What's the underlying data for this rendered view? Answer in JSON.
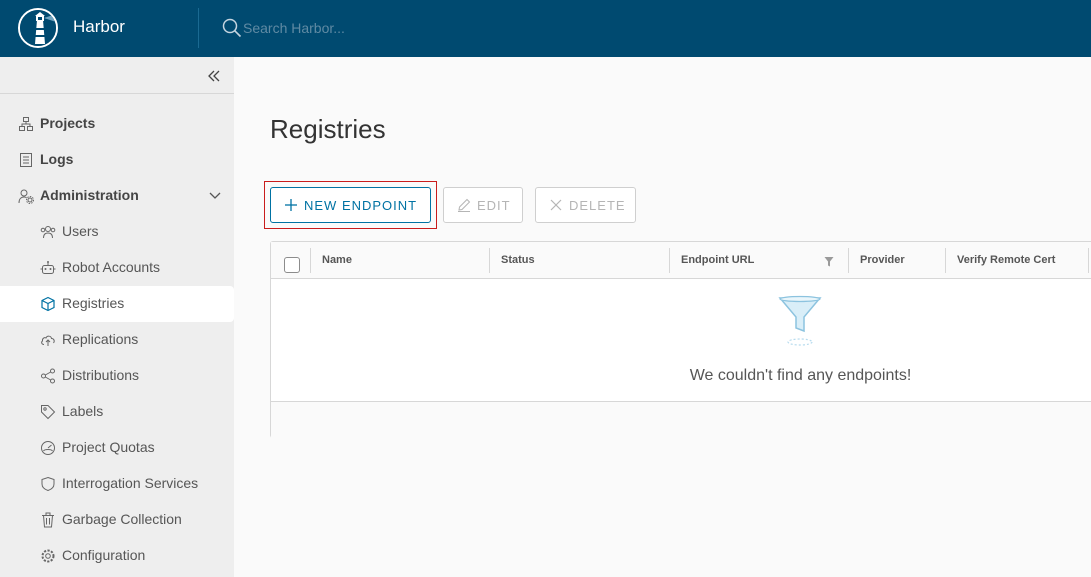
{
  "header": {
    "brand": "Harbor",
    "search_placeholder": "Search Harbor..."
  },
  "sidebar": {
    "items": [
      {
        "label": "Projects",
        "icon": "projects-icon"
      },
      {
        "label": "Logs",
        "icon": "logs-icon"
      },
      {
        "label": "Administration",
        "icon": "administration-icon",
        "expanded": true
      },
      {
        "label": "Users",
        "icon": "users-icon"
      },
      {
        "label": "Robot Accounts",
        "icon": "robot-icon"
      },
      {
        "label": "Registries",
        "icon": "registries-icon",
        "active": true
      },
      {
        "label": "Replications",
        "icon": "replications-icon"
      },
      {
        "label": "Distributions",
        "icon": "distributions-icon"
      },
      {
        "label": "Labels",
        "icon": "labels-icon"
      },
      {
        "label": "Project Quotas",
        "icon": "quotas-icon"
      },
      {
        "label": "Interrogation Services",
        "icon": "interrogation-icon"
      },
      {
        "label": "Garbage Collection",
        "icon": "trash-icon"
      },
      {
        "label": "Configuration",
        "icon": "gear-icon"
      }
    ]
  },
  "main": {
    "title": "Registries",
    "toolbar": {
      "new_label": "NEW ENDPOINT",
      "edit_label": "EDIT",
      "delete_label": "DELETE"
    },
    "grid": {
      "columns": [
        "Name",
        "Status",
        "Endpoint URL",
        "Provider",
        "Verify Remote Cert"
      ],
      "empty_message": "We couldn't find any endpoints!"
    }
  },
  "colors": {
    "header_bg": "#004a70",
    "accent": "#0072a3",
    "highlight": "#c91c1c"
  }
}
